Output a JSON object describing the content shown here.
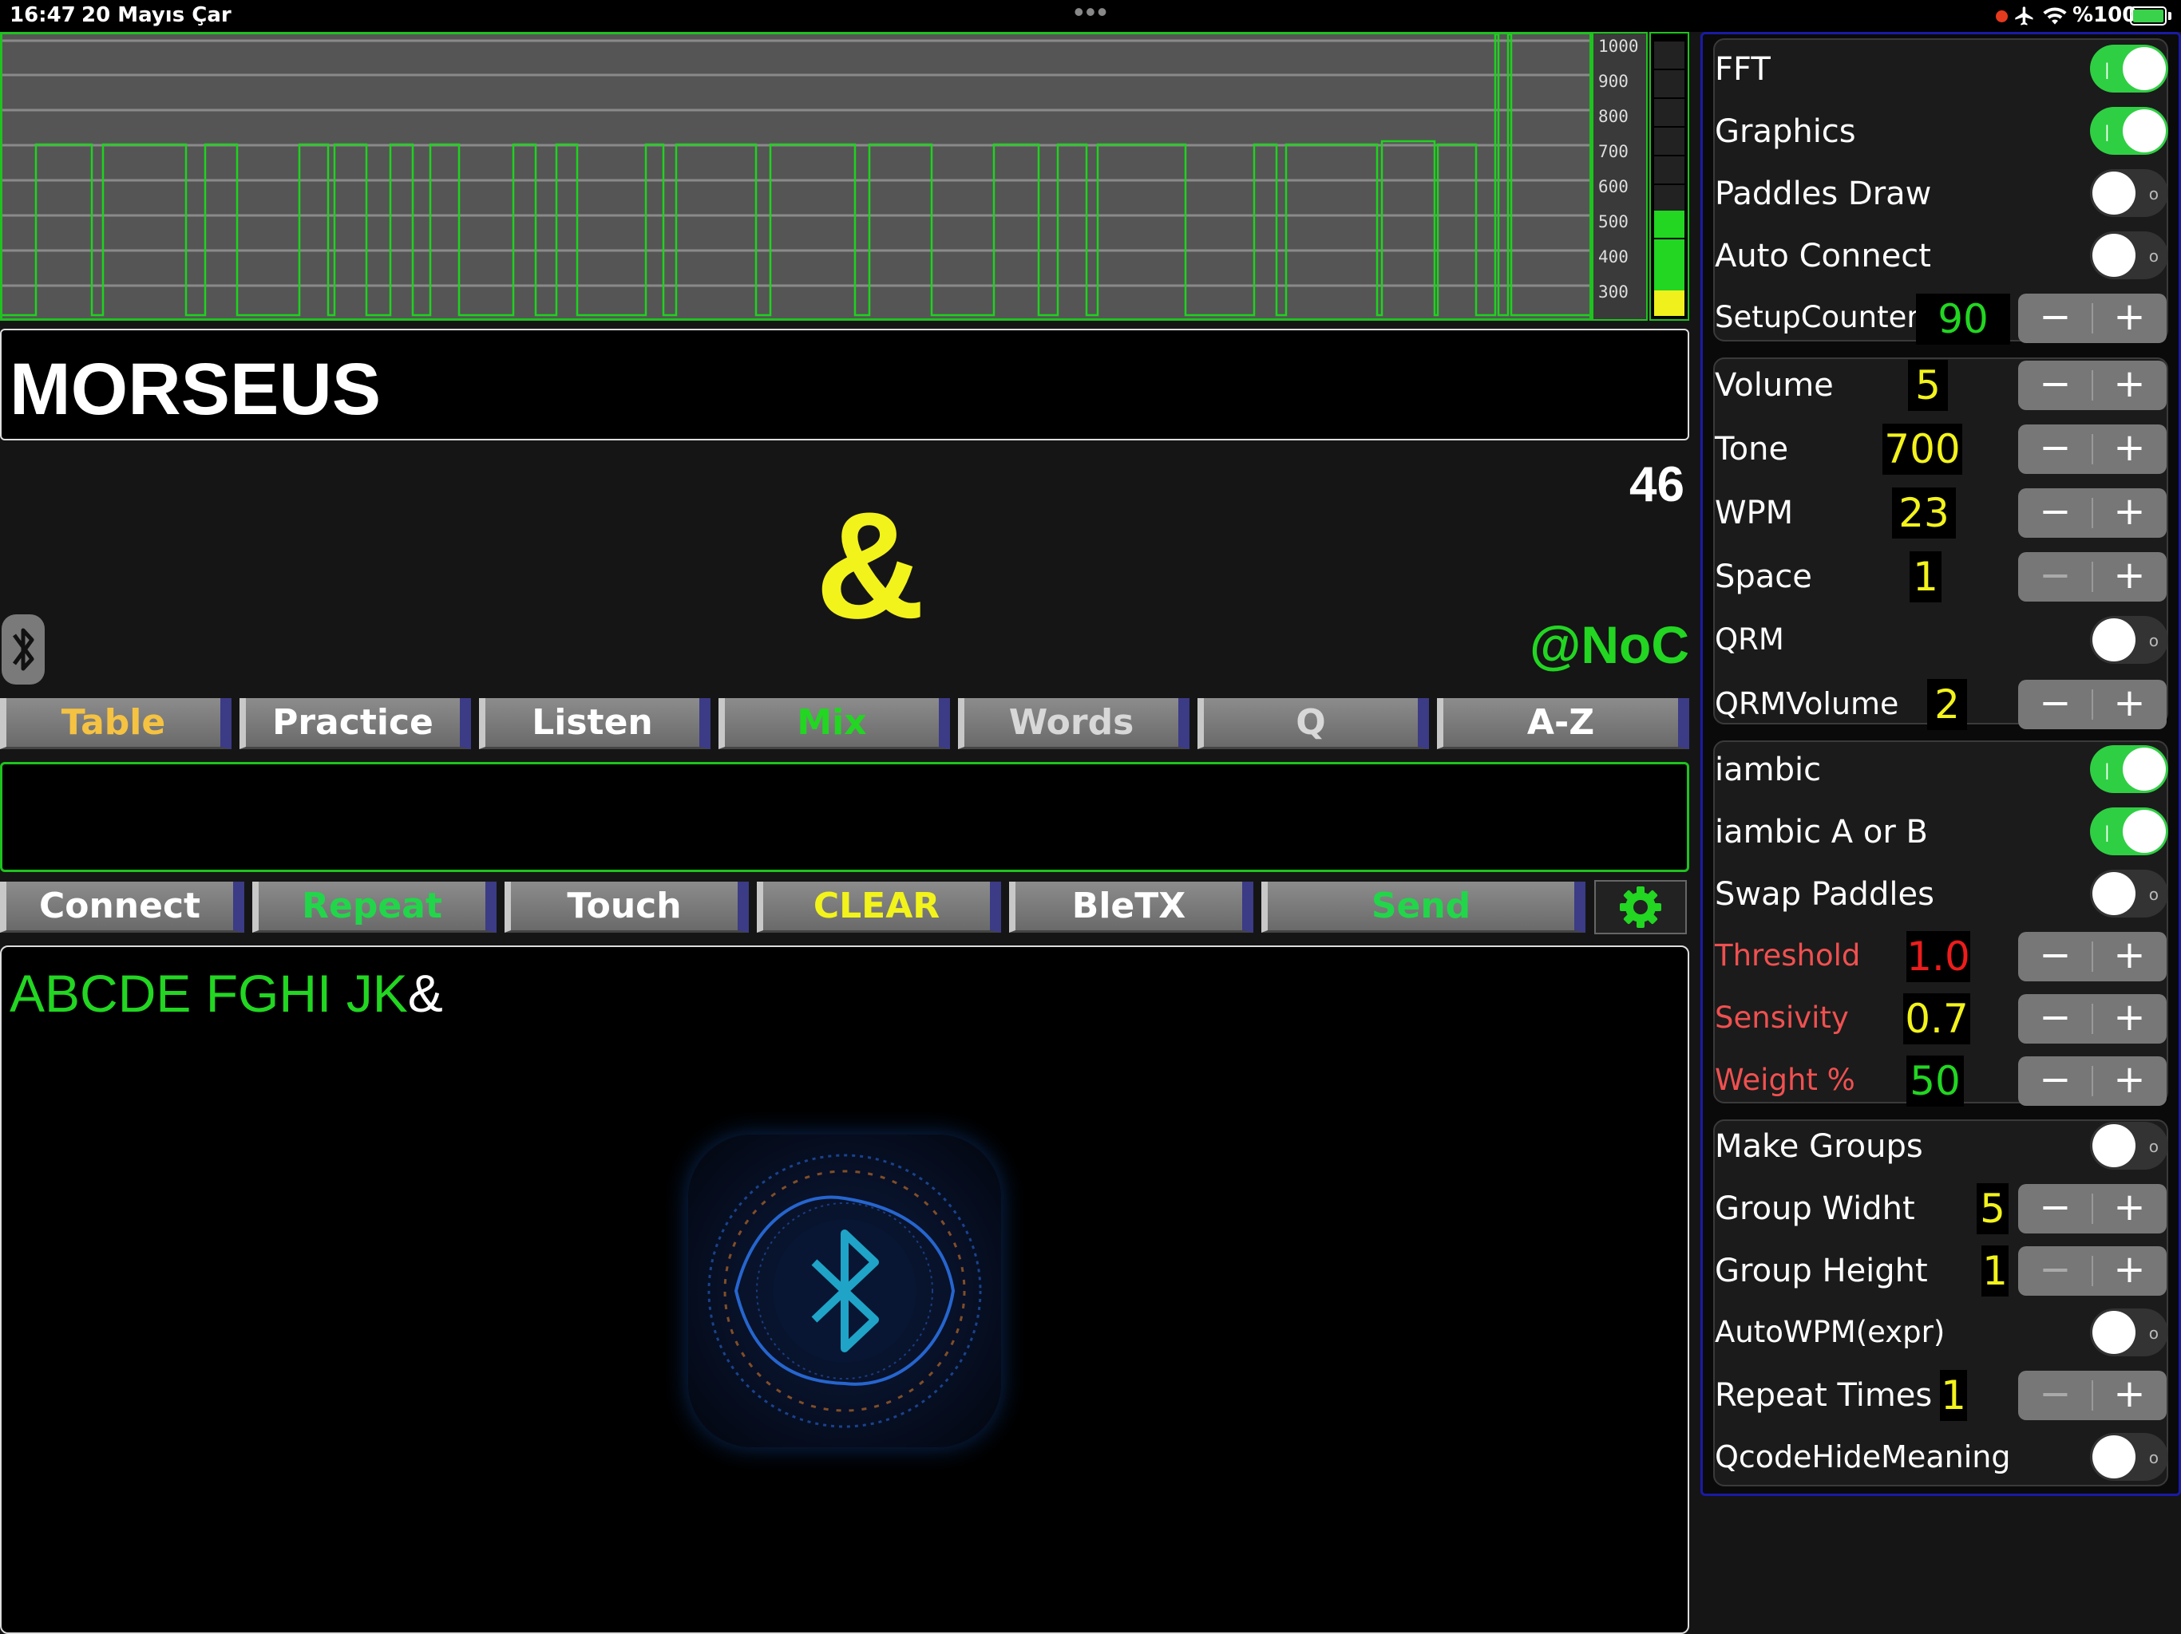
{
  "status_bar": {
    "time": "16:47",
    "date": "20 Mayıs Çar",
    "battery": "%100"
  },
  "scope": {
    "scale_labels": [
      "1000",
      "900",
      "800",
      "700",
      "600",
      "500",
      "400",
      "300"
    ]
  },
  "title": "MORSEUS",
  "counter": "46",
  "current_char": "&",
  "callsign": "@NoC",
  "mode_buttons": [
    {
      "label": "Table",
      "color": "#f5c242"
    },
    {
      "label": "Practice",
      "color": "#ffffff"
    },
    {
      "label": "Listen",
      "color": "#ffffff"
    },
    {
      "label": "Mix",
      "color": "#22d622"
    },
    {
      "label": "Words",
      "color": "#d8d8d8"
    },
    {
      "label": "Q",
      "color": "#d8d8d8"
    },
    {
      "label": "A-Z",
      "color": "#ffffff"
    }
  ],
  "action_buttons": [
    {
      "label": "Connect",
      "color": "#ffffff"
    },
    {
      "label": "Repeat",
      "color": "#22d64a"
    },
    {
      "label": "Touch",
      "color": "#ffffff"
    },
    {
      "label": "CLEAR",
      "color": "#f3f31c"
    },
    {
      "label": "BleTX",
      "color": "#ffffff"
    },
    {
      "label": "Send",
      "color": "#22d64a"
    }
  ],
  "output": {
    "green_text": "ABCDE FGHI JK",
    "white_text": "&"
  },
  "colors": {
    "accent_green": "#1fc21f",
    "value_yellow": "#f3f31c",
    "panel_border": "#1a1aa6"
  },
  "settings": {
    "fft": {
      "label": "FFT",
      "on": true
    },
    "graphics": {
      "label": "Graphics",
      "on": true
    },
    "paddles_draw": {
      "label": "Paddles Draw",
      "on": false
    },
    "auto_connect": {
      "label": "Auto Connect",
      "on": false
    },
    "setup_counter": {
      "label": "SetupCounter",
      "value": "90"
    },
    "volume": {
      "label": "Volume",
      "value": "5"
    },
    "tone": {
      "label": "Tone",
      "value": "700"
    },
    "wpm": {
      "label": "WPM",
      "value": "23"
    },
    "space": {
      "label": "Space",
      "value": "1"
    },
    "qrm": {
      "label": "QRM",
      "on": false
    },
    "qrm_volume": {
      "label": "QRMVolume",
      "value": "2"
    },
    "iambic": {
      "label": "iambic",
      "on": true
    },
    "iambic_ab": {
      "label": "iambic A or B",
      "on": true
    },
    "swap_paddles": {
      "label": "Swap Paddles",
      "on": false
    },
    "threshold": {
      "label": "Threshold",
      "value": "1.0"
    },
    "sensivity": {
      "label": "Sensivity",
      "value": "0.7"
    },
    "weight": {
      "label": "Weight %",
      "value": "50"
    },
    "make_groups": {
      "label": "Make Groups",
      "on": false
    },
    "group_width": {
      "label": "Group Widht",
      "value": "5"
    },
    "group_height": {
      "label": "Group Height",
      "value": "1"
    },
    "auto_wpm": {
      "label": "AutoWPM(expr)",
      "on": false
    },
    "repeat_times": {
      "label": "Repeat Times",
      "value": "1"
    },
    "qcode_hide": {
      "label": "QcodeHideMeaning",
      "on": false
    }
  }
}
